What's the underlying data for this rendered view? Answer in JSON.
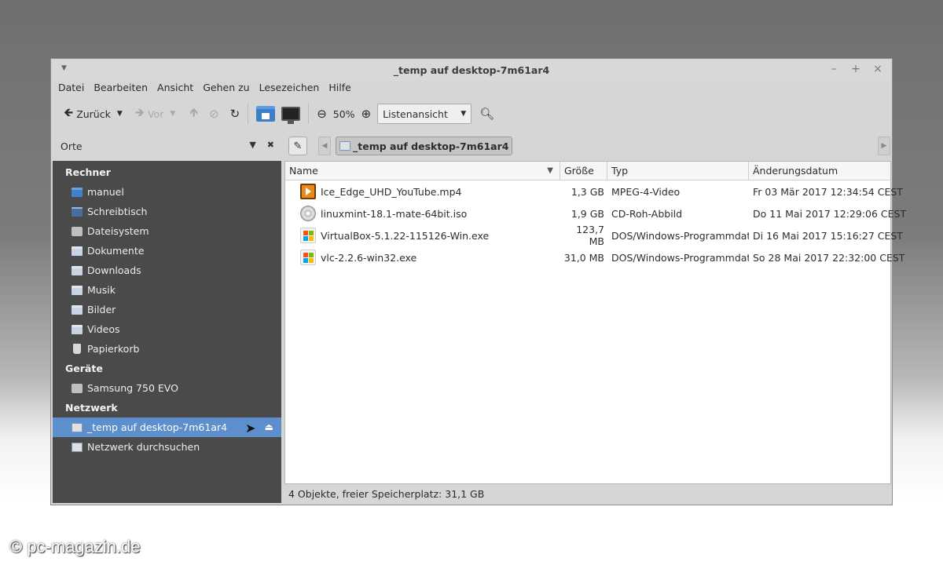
{
  "window": {
    "title": "_temp auf desktop-7m61ar4",
    "controls": [
      "–",
      "+",
      "×"
    ]
  },
  "menubar": [
    "Datei",
    "Bearbeiten",
    "Ansicht",
    "Gehen zu",
    "Lesezeichen",
    "Hilfe"
  ],
  "toolbar": {
    "back_label": "Zurück",
    "forward_label": "Vor",
    "zoom_level": "50%",
    "view_mode": "Listenansicht"
  },
  "places": {
    "label": "Orte",
    "sections": [
      {
        "header": "Rechner",
        "items": [
          {
            "label": "manuel",
            "icon": "home-folder-icon"
          },
          {
            "label": "Schreibtisch",
            "icon": "desktop-icon"
          },
          {
            "label": "Dateisystem",
            "icon": "drive-icon"
          },
          {
            "label": "Dokumente",
            "icon": "folder-icon"
          },
          {
            "label": "Downloads",
            "icon": "folder-icon"
          },
          {
            "label": "Musik",
            "icon": "folder-icon"
          },
          {
            "label": "Bilder",
            "icon": "folder-icon"
          },
          {
            "label": "Videos",
            "icon": "folder-icon"
          },
          {
            "label": "Papierkorb",
            "icon": "trash-icon"
          }
        ]
      },
      {
        "header": "Geräte",
        "items": [
          {
            "label": "Samsung 750 EVO",
            "icon": "drive-icon"
          }
        ]
      },
      {
        "header": "Netzwerk",
        "items": [
          {
            "label": "_temp auf desktop-7m61ar4",
            "icon": "network-share-icon",
            "selected": true
          },
          {
            "label": "Netzwerk durchsuchen",
            "icon": "network-icon"
          }
        ]
      }
    ]
  },
  "pathbar": {
    "current": "_temp auf desktop-7m61ar4"
  },
  "filelist": {
    "columns": [
      "Name",
      "Größe",
      "Typ",
      "Änderungsdatum"
    ],
    "rows": [
      {
        "name": "Ice_Edge_UHD_YouTube.mp4",
        "size": "1,3 GB",
        "type": "MPEG-4-Video",
        "date": "Fr 03 Mär 2017 12:34:54 CEST",
        "icon": "video-file-icon"
      },
      {
        "name": "linuxmint-18.1-mate-64bit.iso",
        "size": "1,9 GB",
        "type": "CD-Roh-Abbild",
        "date": "Do 11 Mai 2017 12:29:06 CEST",
        "icon": "disc-image-icon"
      },
      {
        "name": "VirtualBox-5.1.22-115126-Win.exe",
        "size": "123,7 MB",
        "type": "DOS/Windows-Programmdatei",
        "date": "Di 16 Mai 2017 15:16:27 CEST",
        "icon": "windows-exe-icon"
      },
      {
        "name": "vlc-2.2.6-win32.exe",
        "size": "31,0 MB",
        "type": "DOS/Windows-Programmdatei",
        "date": "So 28 Mai 2017 22:32:00 CEST",
        "icon": "windows-exe-icon"
      }
    ]
  },
  "statusbar": "4 Objekte, freier Speicherplatz: 31,1 GB",
  "watermark": "© pc-magazin.de"
}
